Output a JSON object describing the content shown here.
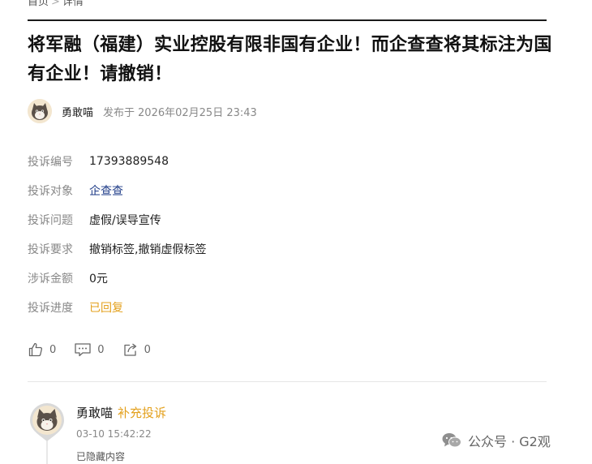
{
  "breadcrumb": {
    "home": "首页",
    "current": "详情"
  },
  "article": {
    "title": "将军融（福建）实业控股有限非国有企业！而企查查将其标注为国有企业！请撤销！",
    "author": "勇敢喵",
    "published_label": "发布于",
    "published_date": "2026年02月25日 23:43"
  },
  "complaint": {
    "items": [
      {
        "label": "投诉编号",
        "value": "17393889548",
        "style": "normal"
      },
      {
        "label": "投诉对象",
        "value": "企查查",
        "style": "link"
      },
      {
        "label": "投诉问题",
        "value": "虚假/误导宣传",
        "style": "normal"
      },
      {
        "label": "投诉要求",
        "value": "撤销标签,撤销虚假标签",
        "style": "normal"
      },
      {
        "label": "涉诉金额",
        "value": "0元",
        "style": "normal"
      },
      {
        "label": "投诉进度",
        "value": "已回复",
        "style": "status"
      }
    ]
  },
  "actions": {
    "like_count": "0",
    "comment_count": "0",
    "share_count": "0"
  },
  "reply": {
    "author": "勇敢喵",
    "type": "补充投诉",
    "time": "03-10 15:42:22",
    "content": "已隐藏内容"
  },
  "watermark": {
    "text": "公众号 · G2观"
  },
  "colors": {
    "accent": "#e3a01c",
    "link": "#1f3c88",
    "muted": "#888888"
  }
}
